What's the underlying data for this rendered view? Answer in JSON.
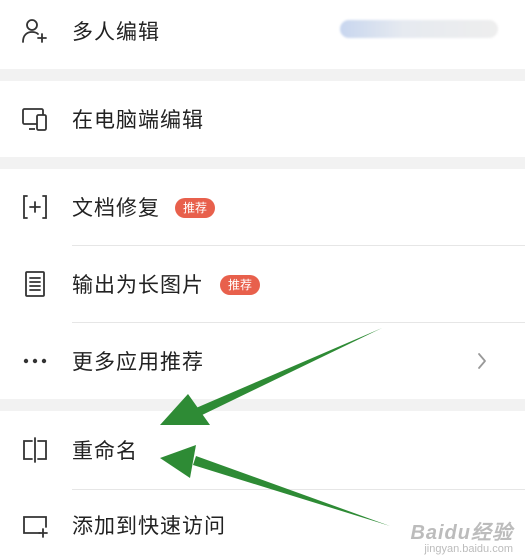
{
  "menu": {
    "items": [
      {
        "label": "多人编辑",
        "icon": "add-user-icon"
      },
      {
        "label": "在电脑端编辑",
        "icon": "desktop-mobile-icon"
      },
      {
        "label": "文档修复",
        "icon": "repair-icon",
        "badge": "推荐"
      },
      {
        "label": "输出为长图片",
        "icon": "long-image-icon",
        "badge": "推荐"
      },
      {
        "label": "更多应用推荐",
        "icon": "more-dots-icon"
      },
      {
        "label": "重命名",
        "icon": "rename-icon"
      },
      {
        "label": "添加到快速访问",
        "icon": "add-quick-access-icon"
      }
    ]
  },
  "colors": {
    "badge": "#e8604c",
    "arrow": "#2e8b35",
    "section_gap": "#f2f2f2"
  },
  "watermark": {
    "main": "Baidu经验",
    "sub": "jingyan.baidu.com"
  }
}
